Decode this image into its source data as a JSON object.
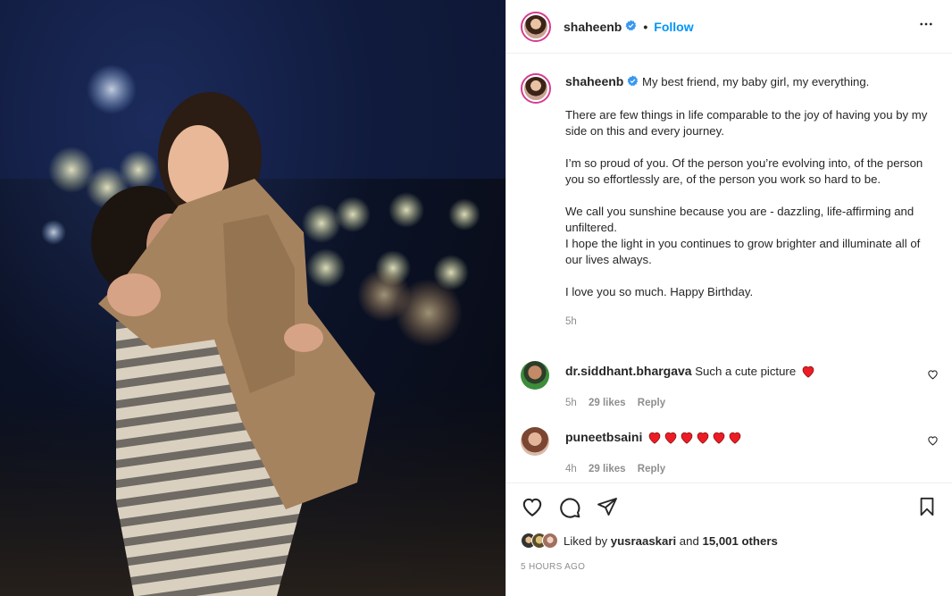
{
  "post": {
    "username": "shaheenb",
    "follow_label": "Follow",
    "dot": "•"
  },
  "caption": {
    "username": "shaheenb",
    "line1": "My best friend, my baby girl, my everything.",
    "p2": "There are few things in life comparable to the joy of having you by my side on this and every journey.",
    "p3": "I’m so proud of you. Of the person you’re evolving into, of the person you so effortlessly are, of the person you work so hard to be.",
    "p4a": "We call you sunshine because you are - dazzling, life-affirming and unfiltered.",
    "p4b": "I hope the light in you continues to grow brighter and illuminate all of our lives always.",
    "p5": "I love you so much. Happy Birthday.",
    "time": "5h"
  },
  "comments": [
    {
      "username": "dr.siddhant.bhargava",
      "text": "Such a cute picture",
      "time": "5h",
      "likes": "29 likes",
      "reply": "Reply"
    },
    {
      "username": "puneetbsaini",
      "text": "",
      "time": "4h",
      "likes": "29 likes",
      "reply": "Reply"
    }
  ],
  "likes": {
    "prefix": "Liked by",
    "user": "yusraaskari",
    "conj": "and",
    "others": "15,001 others"
  },
  "timestamp": "5 HOURS AGO",
  "colors": {
    "accent": "#0095f6",
    "heart": "#ed1c24",
    "verified": "#3897f0"
  },
  "icons": [
    "verified-icon",
    "more-icon",
    "heart-icon",
    "comment-icon",
    "share-icon",
    "save-icon",
    "red-heart-emoji"
  ]
}
